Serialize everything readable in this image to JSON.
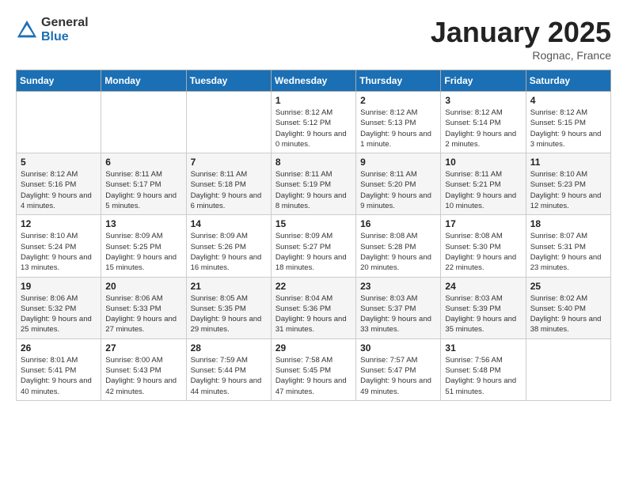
{
  "logo": {
    "general": "General",
    "blue": "Blue"
  },
  "header": {
    "month": "January 2025",
    "location": "Rognac, France"
  },
  "weekdays": [
    "Sunday",
    "Monday",
    "Tuesday",
    "Wednesday",
    "Thursday",
    "Friday",
    "Saturday"
  ],
  "weeks": [
    [
      {
        "day": "",
        "sunrise": "",
        "sunset": "",
        "daylight": ""
      },
      {
        "day": "",
        "sunrise": "",
        "sunset": "",
        "daylight": ""
      },
      {
        "day": "",
        "sunrise": "",
        "sunset": "",
        "daylight": ""
      },
      {
        "day": "1",
        "sunrise": "Sunrise: 8:12 AM",
        "sunset": "Sunset: 5:12 PM",
        "daylight": "Daylight: 9 hours and 0 minutes."
      },
      {
        "day": "2",
        "sunrise": "Sunrise: 8:12 AM",
        "sunset": "Sunset: 5:13 PM",
        "daylight": "Daylight: 9 hours and 1 minute."
      },
      {
        "day": "3",
        "sunrise": "Sunrise: 8:12 AM",
        "sunset": "Sunset: 5:14 PM",
        "daylight": "Daylight: 9 hours and 2 minutes."
      },
      {
        "day": "4",
        "sunrise": "Sunrise: 8:12 AM",
        "sunset": "Sunset: 5:15 PM",
        "daylight": "Daylight: 9 hours and 3 minutes."
      }
    ],
    [
      {
        "day": "5",
        "sunrise": "Sunrise: 8:12 AM",
        "sunset": "Sunset: 5:16 PM",
        "daylight": "Daylight: 9 hours and 4 minutes."
      },
      {
        "day": "6",
        "sunrise": "Sunrise: 8:11 AM",
        "sunset": "Sunset: 5:17 PM",
        "daylight": "Daylight: 9 hours and 5 minutes."
      },
      {
        "day": "7",
        "sunrise": "Sunrise: 8:11 AM",
        "sunset": "Sunset: 5:18 PM",
        "daylight": "Daylight: 9 hours and 6 minutes."
      },
      {
        "day": "8",
        "sunrise": "Sunrise: 8:11 AM",
        "sunset": "Sunset: 5:19 PM",
        "daylight": "Daylight: 9 hours and 8 minutes."
      },
      {
        "day": "9",
        "sunrise": "Sunrise: 8:11 AM",
        "sunset": "Sunset: 5:20 PM",
        "daylight": "Daylight: 9 hours and 9 minutes."
      },
      {
        "day": "10",
        "sunrise": "Sunrise: 8:11 AM",
        "sunset": "Sunset: 5:21 PM",
        "daylight": "Daylight: 9 hours and 10 minutes."
      },
      {
        "day": "11",
        "sunrise": "Sunrise: 8:10 AM",
        "sunset": "Sunset: 5:23 PM",
        "daylight": "Daylight: 9 hours and 12 minutes."
      }
    ],
    [
      {
        "day": "12",
        "sunrise": "Sunrise: 8:10 AM",
        "sunset": "Sunset: 5:24 PM",
        "daylight": "Daylight: 9 hours and 13 minutes."
      },
      {
        "day": "13",
        "sunrise": "Sunrise: 8:09 AM",
        "sunset": "Sunset: 5:25 PM",
        "daylight": "Daylight: 9 hours and 15 minutes."
      },
      {
        "day": "14",
        "sunrise": "Sunrise: 8:09 AM",
        "sunset": "Sunset: 5:26 PM",
        "daylight": "Daylight: 9 hours and 16 minutes."
      },
      {
        "day": "15",
        "sunrise": "Sunrise: 8:09 AM",
        "sunset": "Sunset: 5:27 PM",
        "daylight": "Daylight: 9 hours and 18 minutes."
      },
      {
        "day": "16",
        "sunrise": "Sunrise: 8:08 AM",
        "sunset": "Sunset: 5:28 PM",
        "daylight": "Daylight: 9 hours and 20 minutes."
      },
      {
        "day": "17",
        "sunrise": "Sunrise: 8:08 AM",
        "sunset": "Sunset: 5:30 PM",
        "daylight": "Daylight: 9 hours and 22 minutes."
      },
      {
        "day": "18",
        "sunrise": "Sunrise: 8:07 AM",
        "sunset": "Sunset: 5:31 PM",
        "daylight": "Daylight: 9 hours and 23 minutes."
      }
    ],
    [
      {
        "day": "19",
        "sunrise": "Sunrise: 8:06 AM",
        "sunset": "Sunset: 5:32 PM",
        "daylight": "Daylight: 9 hours and 25 minutes."
      },
      {
        "day": "20",
        "sunrise": "Sunrise: 8:06 AM",
        "sunset": "Sunset: 5:33 PM",
        "daylight": "Daylight: 9 hours and 27 minutes."
      },
      {
        "day": "21",
        "sunrise": "Sunrise: 8:05 AM",
        "sunset": "Sunset: 5:35 PM",
        "daylight": "Daylight: 9 hours and 29 minutes."
      },
      {
        "day": "22",
        "sunrise": "Sunrise: 8:04 AM",
        "sunset": "Sunset: 5:36 PM",
        "daylight": "Daylight: 9 hours and 31 minutes."
      },
      {
        "day": "23",
        "sunrise": "Sunrise: 8:03 AM",
        "sunset": "Sunset: 5:37 PM",
        "daylight": "Daylight: 9 hours and 33 minutes."
      },
      {
        "day": "24",
        "sunrise": "Sunrise: 8:03 AM",
        "sunset": "Sunset: 5:39 PM",
        "daylight": "Daylight: 9 hours and 35 minutes."
      },
      {
        "day": "25",
        "sunrise": "Sunrise: 8:02 AM",
        "sunset": "Sunset: 5:40 PM",
        "daylight": "Daylight: 9 hours and 38 minutes."
      }
    ],
    [
      {
        "day": "26",
        "sunrise": "Sunrise: 8:01 AM",
        "sunset": "Sunset: 5:41 PM",
        "daylight": "Daylight: 9 hours and 40 minutes."
      },
      {
        "day": "27",
        "sunrise": "Sunrise: 8:00 AM",
        "sunset": "Sunset: 5:43 PM",
        "daylight": "Daylight: 9 hours and 42 minutes."
      },
      {
        "day": "28",
        "sunrise": "Sunrise: 7:59 AM",
        "sunset": "Sunset: 5:44 PM",
        "daylight": "Daylight: 9 hours and 44 minutes."
      },
      {
        "day": "29",
        "sunrise": "Sunrise: 7:58 AM",
        "sunset": "Sunset: 5:45 PM",
        "daylight": "Daylight: 9 hours and 47 minutes."
      },
      {
        "day": "30",
        "sunrise": "Sunrise: 7:57 AM",
        "sunset": "Sunset: 5:47 PM",
        "daylight": "Daylight: 9 hours and 49 minutes."
      },
      {
        "day": "31",
        "sunrise": "Sunrise: 7:56 AM",
        "sunset": "Sunset: 5:48 PM",
        "daylight": "Daylight: 9 hours and 51 minutes."
      },
      {
        "day": "",
        "sunrise": "",
        "sunset": "",
        "daylight": ""
      }
    ]
  ]
}
